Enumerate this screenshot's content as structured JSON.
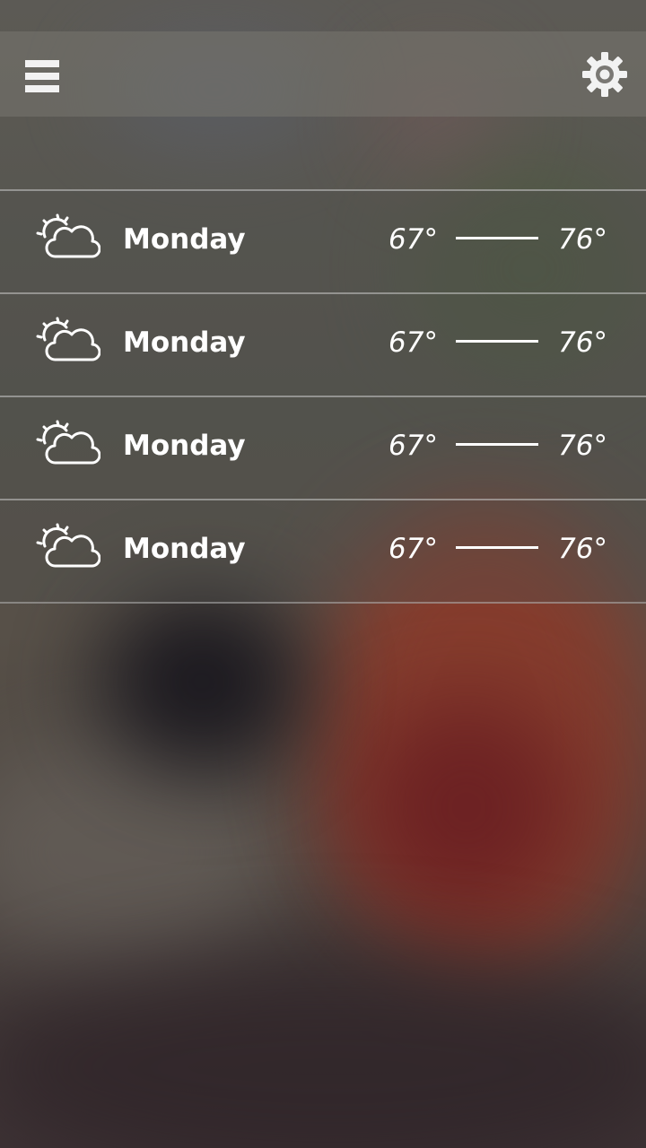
{
  "header": {
    "menu_icon": "hamburger-menu-icon",
    "settings_icon": "gear-icon"
  },
  "forecast": [
    {
      "day": "Monday",
      "low": "67°",
      "high": "76°",
      "icon": "partly-cloudy-icon"
    },
    {
      "day": "Monday",
      "low": "67°",
      "high": "76°",
      "icon": "partly-cloudy-icon"
    },
    {
      "day": "Monday",
      "low": "67°",
      "high": "76°",
      "icon": "partly-cloudy-icon"
    },
    {
      "day": "Monday",
      "low": "67°",
      "high": "76°",
      "icon": "partly-cloudy-icon"
    }
  ],
  "colors": {
    "text": "#ffffff",
    "divider": "#c8c8c8"
  }
}
